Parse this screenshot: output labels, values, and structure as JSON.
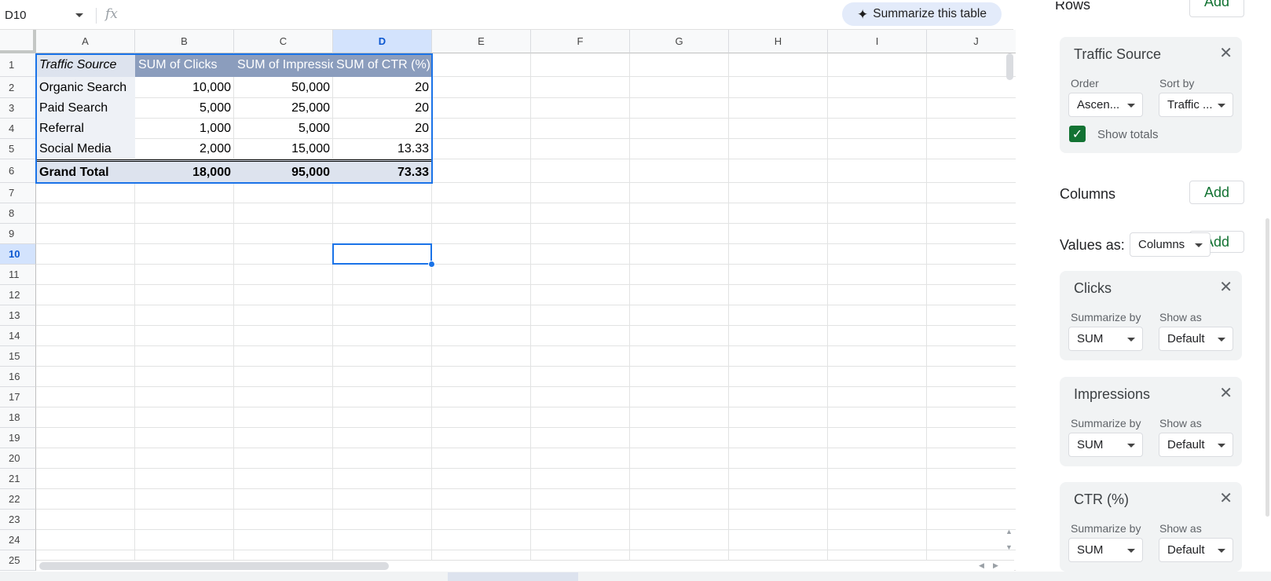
{
  "formula_bar": {
    "name_box": "D10",
    "fx_label": "fx",
    "summarize_button": "Summarize this table",
    "sparkle_icon": "✦"
  },
  "grid": {
    "columns": [
      "A",
      "B",
      "C",
      "D",
      "E",
      "F",
      "G",
      "H",
      "I",
      "J"
    ],
    "selected_column": "D",
    "rows": [
      "1",
      "2",
      "3",
      "4",
      "5",
      "6",
      "7",
      "8",
      "9",
      "10",
      "11",
      "12",
      "13",
      "14",
      "15",
      "16",
      "17",
      "18",
      "19",
      "20",
      "21",
      "22",
      "23",
      "24",
      "25"
    ],
    "selected_row": "10",
    "pivot": {
      "headers": [
        "Traffic Source",
        "SUM of Clicks",
        "SUM of Impressions",
        "SUM of CTR (%)"
      ],
      "rows": [
        {
          "label": "Organic Search",
          "clicks": "10,000",
          "impressions": "50,000",
          "ctr": "20"
        },
        {
          "label": "Paid Search",
          "clicks": "5,000",
          "impressions": "25,000",
          "ctr": "20"
        },
        {
          "label": "Referral",
          "clicks": "1,000",
          "impressions": "5,000",
          "ctr": "20"
        },
        {
          "label": "Social Media",
          "clicks": "2,000",
          "impressions": "15,000",
          "ctr": "13.33"
        }
      ],
      "total": {
        "label": "Grand Total",
        "clicks": "18,000",
        "impressions": "95,000",
        "ctr": "73.33"
      }
    }
  },
  "panel": {
    "rows_title": "Rows",
    "add_label": "Add",
    "rows_field": {
      "title": "Traffic Source",
      "order_label": "Order",
      "order_value": "Ascen...",
      "sort_by_label": "Sort by",
      "sort_by_value": "Traffic ...",
      "show_totals_label": "Show totals",
      "show_totals_checked": true
    },
    "columns_title": "Columns",
    "values_as_label": "Values as:",
    "values_as_value": "Columns",
    "value_fields": [
      {
        "title": "Clicks",
        "summarize_label": "Summarize by",
        "summarize_value": "SUM",
        "show_as_label": "Show as",
        "show_as_value": "Default"
      },
      {
        "title": "Impressions",
        "summarize_label": "Summarize by",
        "summarize_value": "SUM",
        "show_as_label": "Show as",
        "show_as_value": "Default"
      },
      {
        "title": "CTR (%)",
        "summarize_label": "Summarize by",
        "summarize_value": "SUM",
        "show_as_label": "Show as",
        "show_as_value": "Default"
      }
    ]
  },
  "colors": {
    "accent": "#1a73e8",
    "pivot_header": "#8b9dbd",
    "pivot_light": "#dde3ee",
    "add_green": "#137333"
  }
}
